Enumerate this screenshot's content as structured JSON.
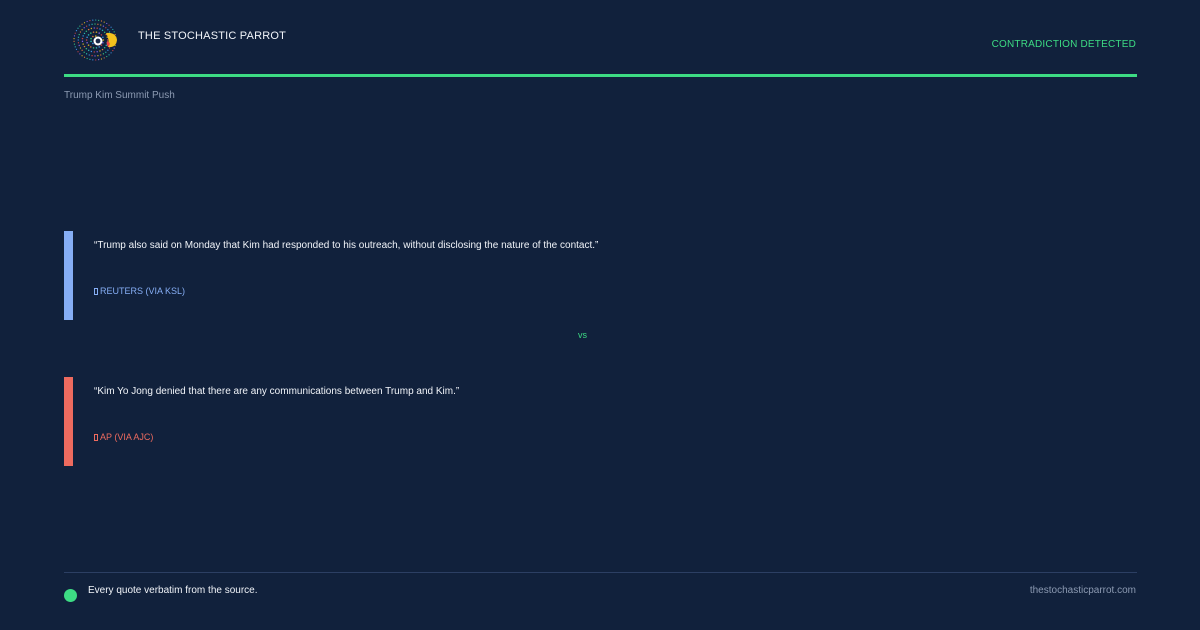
{
  "brand": {
    "name": "THE STOCHASTIC PARROT",
    "logo_icon": "parrot-logo-icon"
  },
  "header": {
    "status": "CONTRADICTION DETECTED"
  },
  "topic": "Trump Kim Summit Push",
  "quotes": [
    {
      "text": "“Trump also said on Monday that Kim had responded to his outreach, without disclosing the nature of the contact.”",
      "source": "REUTERS (VIA KSL)",
      "accent_color": "#86aef5"
    },
    {
      "text": "“Kim Yo Jong denied that there are any communications between Trump and Kim.”",
      "source": "AP (VIA AJC)",
      "accent_color": "#ee6b5f"
    }
  ],
  "versus": "vs",
  "footer": {
    "note": "Every quote verbatim from the source.",
    "url": "thestochasticparrot.com"
  },
  "colors": {
    "background": "#11213c",
    "accent": "#3ddc84"
  }
}
